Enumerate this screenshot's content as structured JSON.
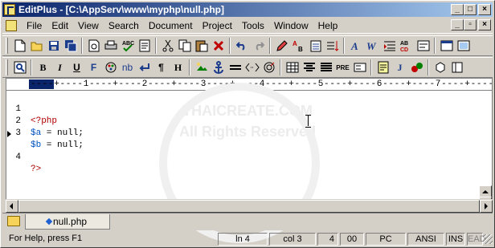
{
  "window": {
    "title": "EditPlus - [C:\\AppServ\\www\\myphp\\null.php]",
    "buttons": [
      "_",
      "□",
      "×"
    ],
    "mdi_buttons": [
      "_",
      "▫",
      "×"
    ]
  },
  "menubar": {
    "items": [
      "File",
      "Edit",
      "View",
      "Search",
      "Document",
      "Project",
      "Tools",
      "Window",
      "Help"
    ]
  },
  "toolbar1": {
    "icons": [
      "new-file-icon",
      "open-folder-icon",
      "save-icon",
      "save-all-icon",
      "print-preview-icon",
      "print-icon",
      "spell-check-icon",
      "browser-icon",
      "cut-icon",
      "copy-icon",
      "paste-icon",
      "delete-icon",
      "undo-icon",
      "redo-icon",
      "highlighter-icon",
      "find-replace-icon",
      "clipboard-icon",
      "word-wrap-icon",
      "font-icon",
      "bold-w-icon",
      "indent-icon",
      "abcd-icon",
      "text-icon",
      "screen-icon",
      "fullscreen-icon"
    ]
  },
  "toolbar2": {
    "labels": [
      "B",
      "I",
      "U",
      "F",
      "nb",
      "H",
      "¶",
      "H",
      "PRE",
      "J"
    ]
  },
  "ruler": {
    "text": "----+----1----+----2----+----3----+----4----+----5----+----6----+----7----+----8"
  },
  "editor": {
    "lines": [
      {
        "number": "1",
        "code": "<?php"
      },
      {
        "number": "2",
        "var": "$a",
        "rest": " = null;"
      },
      {
        "number": "3",
        "var": "$b",
        "rest": " = null;"
      },
      {
        "number": "4",
        "code": "?>"
      }
    ],
    "watermark_lines": [
      "THAICREATE.COM",
      "All Rights Reserved"
    ]
  },
  "tabs": {
    "open_file": "null.php"
  },
  "status": {
    "help": "For Help, press F1",
    "line": "ln 4",
    "col": "col 3",
    "count": "4",
    "code": "00",
    "mode": "PC",
    "encoding": "ANSI",
    "ins": "INS",
    "ovr": "EAD"
  },
  "colors": {
    "title_start": "#0a246a",
    "title_end": "#a6caf0",
    "php_tag": "#b00000",
    "variable": "#0050c0"
  }
}
